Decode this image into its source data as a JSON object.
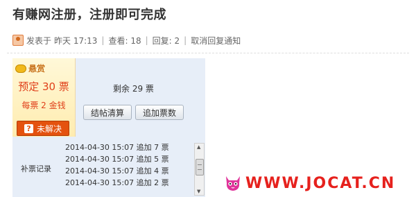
{
  "post": {
    "title": "有赚网注册，注册即可完成"
  },
  "meta": {
    "posted_prefix": "发表于",
    "posted_time": "昨天 17:13",
    "separator": "|",
    "views": "查看: 18",
    "replies": "回复: 2",
    "cancel_notify": "取消回复通知"
  },
  "reward": {
    "tag": "悬赏",
    "preset": "预定 30 票",
    "per_vote": "每票 2 金钱",
    "status_icon": "?",
    "status": "未解决",
    "remaining": "剩余 29 票"
  },
  "buttons": {
    "settle": "结帖清算",
    "add_votes": "追加票数"
  },
  "records": {
    "label": "补票记录",
    "items": [
      "2014-04-30 15:07 追加 7 票",
      "2014-04-30 15:07 追加 5 票",
      "2014-04-30 15:07 追加 4 票",
      "2014-04-30 15:07 追加 2 票"
    ]
  },
  "watermark": {
    "text": "WWW.JOCAT.CN"
  },
  "colors": {
    "accent_red": "#e0401a",
    "status_orange": "#e4520f",
    "panel_bg": "#e7eef8",
    "reward_bg": "#fff3c4"
  }
}
